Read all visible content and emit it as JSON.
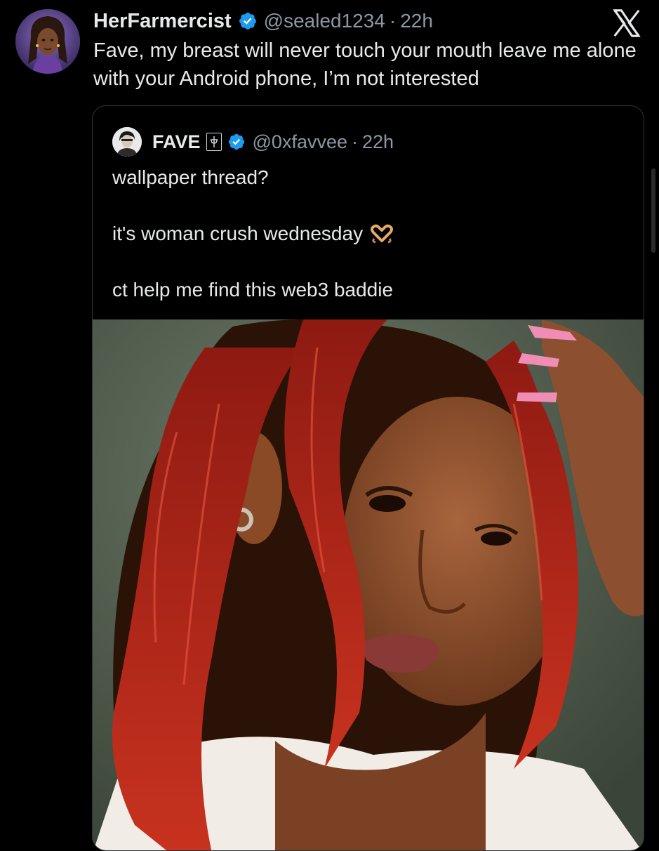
{
  "tweet": {
    "display_name": "HerFarmercist",
    "handle": "@sealed1234",
    "separator": "·",
    "time": "22h",
    "text": "Fave, my breast will never touch your mouth leave me alone with your Android phone, I’m not interested"
  },
  "quoted_tweet": {
    "display_name": "FAVE",
    "handle": "@0xfavvee",
    "separator": "·",
    "time": "22h",
    "lines": [
      "wallpaper thread?",
      "it's woman crush wednesday",
      "ct help me find this web3 baddie"
    ],
    "emoji": "heart-hands"
  },
  "icons": {
    "brand": "x-logo-icon",
    "verified": "verified-badge-icon"
  },
  "colors": {
    "background": "#000000",
    "text": "#e7e9ea",
    "muted": "#8b98a5",
    "verified": "#1d9bf0",
    "hair": "#b3231c",
    "nails": "#f08db4"
  }
}
